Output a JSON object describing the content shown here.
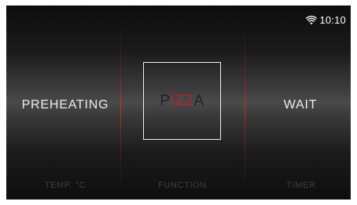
{
  "status": {
    "wifi_icon": "wifi-icon",
    "time": "10:10"
  },
  "left_section": {
    "label": "PREHEATING",
    "caption": "TEMP. °C"
  },
  "center_section": {
    "letters": [
      {
        "char": "P",
        "color": "#222222"
      },
      {
        "char": "I",
        "color": "#b7222a"
      },
      {
        "char": "Z",
        "color": "#b7222a"
      },
      {
        "char": "Z",
        "color": "#b7222a"
      },
      {
        "char": "A",
        "color": "#222222"
      }
    ],
    "caption": "FUNCTION"
  },
  "right_section": {
    "label": "WAIT",
    "caption": "TIMER"
  },
  "colors": {
    "accent_red": "#b7222a",
    "divider_red": "#dc2828",
    "text_light": "#ececec"
  }
}
